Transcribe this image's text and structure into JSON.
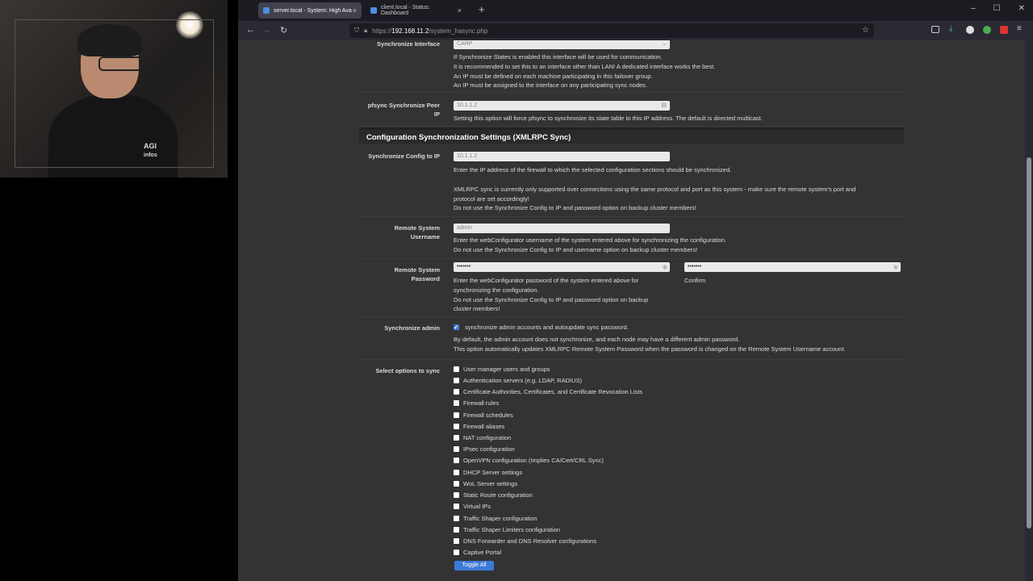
{
  "webcam": {
    "shirt_line1": "AGI",
    "shirt_line2": "infos"
  },
  "browser": {
    "tabs": [
      {
        "title": "server.local - System: High Ava",
        "active": true
      },
      {
        "title": "client.local - Status: Dashboard",
        "active": false
      }
    ],
    "new_tab": "+",
    "url_prefix": "https://",
    "url_host": "192.168.11.2",
    "url_path": "/system_hasync.php"
  },
  "form": {
    "sync_interface": {
      "label": "Synchronize Interface",
      "value": "CARP",
      "help": [
        "If Synchronize States is enabled this interface will be used for communication.",
        "It is recommended to set this to an interface other than LAN! A dedicated interface works the best.",
        "An IP must be defined on each machine participating in this failover group.",
        "An IP must be assigned to the interface on any participating sync nodes."
      ]
    },
    "pfsync_peer": {
      "label_line1": "pfsync Synchronize Peer",
      "label_line2": "IP",
      "value": "10.1.1.2",
      "help": "Setting this option will force pfsync to synchronize its state table to this IP address. The default is directed multicast."
    },
    "section_title": "Configuration Synchronization Settings (XMLRPC Sync)",
    "sync_config_ip": {
      "label": "Synchronize Config to IP",
      "value": "10.1.1.2",
      "help1": "Enter the IP address of the firewall to which the selected configuration sections should be synchronized.",
      "help2": "XMLRPC sync is currently only supported over connections using the same protocol and port as this system - make sure the remote system's port and",
      "help3": "protocol are set accordingly!",
      "help4": "Do not use the Synchronize Config to IP and password option on backup cluster members!"
    },
    "remote_username": {
      "label_line1": "Remote System",
      "label_line2": "Username",
      "value": "admin",
      "help1": "Enter the webConfigurator username of the system entered above for synchronizing the configuration.",
      "help2": "Do not use the Synchronize Config to IP and username option on backup cluster members!"
    },
    "remote_password": {
      "label_line1": "Remote System",
      "label_line2": "Password",
      "value": "•••••••",
      "confirm_value": "•••••••",
      "help1": "Enter the webConfigurator password of the system entered above for",
      "help2": "synchronizing the configuration.",
      "help3": "Do not use the Synchronize Config to IP and password option on backup",
      "help4": "cluster members!",
      "confirm_label": "Confirm"
    },
    "sync_admin": {
      "label": "Synchronize admin",
      "checkbox_label": "synchronize admin accounts and autoupdate sync password.",
      "help1": "By default, the admin account does not synchronize, and each node may have a different admin password.",
      "help2": "This option automatically updates XMLRPC Remote System Password when the password is changed on the Remote System Username account."
    },
    "select_options": {
      "label": "Select options to sync",
      "options": [
        "User manager users and groups",
        "Authentication servers (e.g. LDAP, RADIUS)",
        "Certificate Authorities, Certificates, and Certificate Revocation Lists",
        "Firewall rules",
        "Firewall schedules",
        "Firewall aliases",
        "NAT configuration",
        "IPsec configuration",
        "OpenVPN configuration (Implies CA/Cert/CRL Sync)",
        "DHCP Server settings",
        "WoL Server settings",
        "Static Route configuration",
        "Virtual IPs",
        "Traffic Shaper configuration",
        "Traffic Shaper Limiters configuration",
        "DNS Forwarder and DNS Resolver configurations",
        "Captive Portal"
      ],
      "toggle_all": "Toggle All"
    }
  }
}
